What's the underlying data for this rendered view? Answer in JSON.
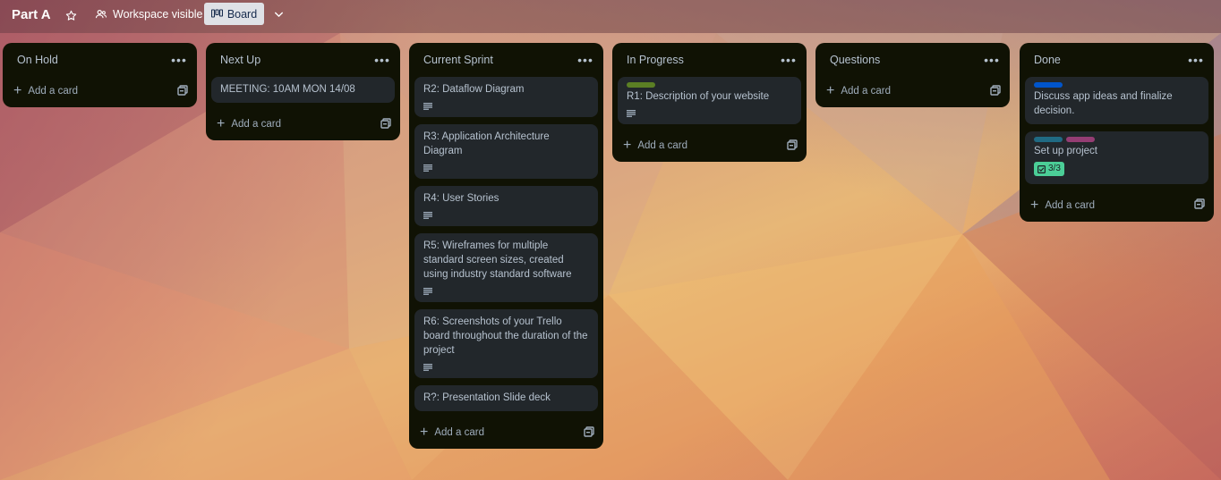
{
  "board": {
    "title": "Part A",
    "visibility_label": "Workspace visible",
    "view_label": "Board"
  },
  "colors": {
    "label_green": "#5b7f24",
    "label_blue": "#0055cc",
    "label_teal": "#206a83",
    "label_magenta": "#943d73",
    "checklist_complete": "#4bce97"
  },
  "add_card_label": "Add a card",
  "lists": [
    {
      "title": "On Hold",
      "cards": []
    },
    {
      "title": "Next Up",
      "cards": [
        {
          "title": "MEETING: 10AM MON 14/08"
        }
      ]
    },
    {
      "title": "Current Sprint",
      "cards": [
        {
          "title": "R2: Dataflow Diagram",
          "has_description": true
        },
        {
          "title": "R3: Application Architecture Diagram",
          "has_description": true
        },
        {
          "title": "R4: User Stories",
          "has_description": true
        },
        {
          "title": "R5: Wireframes for multiple standard screen sizes, created using industry standard software",
          "has_description": true
        },
        {
          "title": "R6: Screenshots of your Trello board throughout the duration of the project",
          "has_description": true
        },
        {
          "title": "R?: Presentation Slide deck"
        }
      ]
    },
    {
      "title": "In Progress",
      "cards": [
        {
          "title": "R1: Description of your website",
          "labels": [
            "green"
          ],
          "has_description": true
        }
      ]
    },
    {
      "title": "Questions",
      "cards": []
    },
    {
      "title": "Done",
      "cards": [
        {
          "title": "Discuss app ideas and finalize decision.",
          "labels": [
            "blue"
          ]
        },
        {
          "title": "Set up project",
          "labels": [
            "teal",
            "magenta"
          ],
          "checklist": "3/3"
        }
      ]
    }
  ]
}
